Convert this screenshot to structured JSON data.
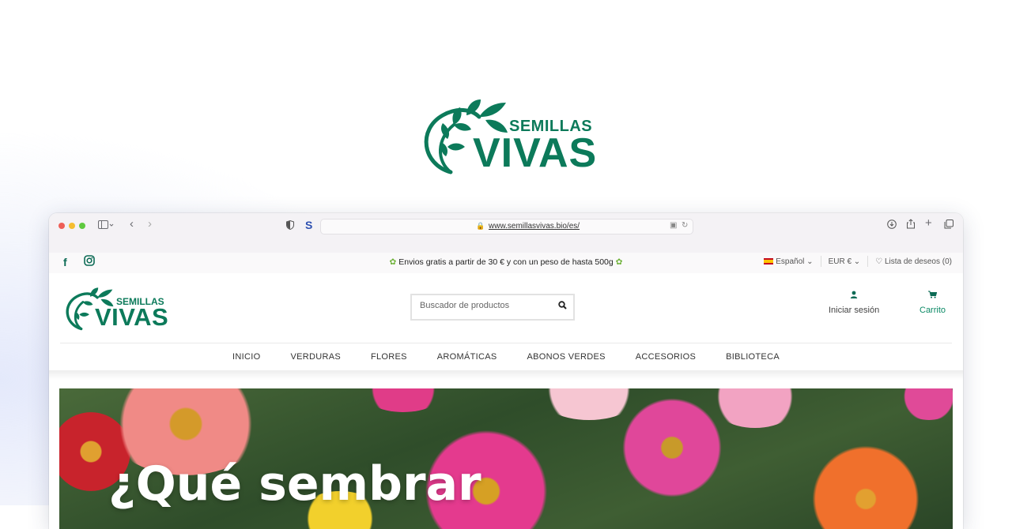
{
  "brand": {
    "word_small": "SEMILLAS",
    "word_big": "VIVAS",
    "color": "#0c7a5a"
  },
  "browser": {
    "url": "www.semillasvivas.bio/es/",
    "toolbar_icons": [
      "sidebar-icon",
      "back-icon",
      "forward-icon",
      "shield-icon",
      "extension-s-icon",
      "lock-icon",
      "translate-icon",
      "reload-icon",
      "download-icon",
      "share-icon",
      "new-tab-icon",
      "tabs-overview-icon"
    ],
    "extension_label": "S"
  },
  "topbar": {
    "social": [
      "facebook-icon",
      "instagram-icon"
    ],
    "shipping_text": "Envios gratis a partir de 30 € y con un peso de hasta 500g",
    "language": "Español",
    "currency": "EUR €",
    "wishlist": "Lista de deseos (0)"
  },
  "header": {
    "search_placeholder": "Buscador de productos",
    "login_label": "Iniciar sesión",
    "cart_label": "Carrito"
  },
  "nav": {
    "items": [
      "INICIO",
      "VERDURAS",
      "FLORES",
      "AROMÁTICAS",
      "ABONOS VERDES",
      "ACCESORIOS",
      "BIBLIOTECA"
    ]
  },
  "banner": {
    "title": "¿Qué sembrar"
  },
  "colors": {
    "accent": "#0c6b55",
    "sprout": "#6fb23a"
  }
}
